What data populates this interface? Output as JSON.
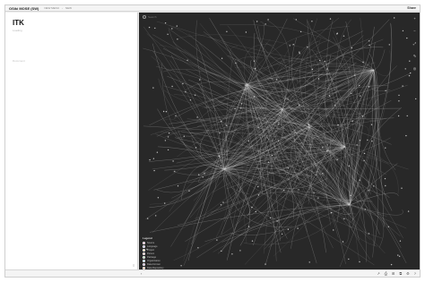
{
  "app": {
    "title": "OSiki MOSE (SW)",
    "breadcrumbs": [
      "NEW MENU",
      "NEW"
    ],
    "top_action": "Share"
  },
  "left_pane": {
    "title": "ITK",
    "subtitle": "Loading",
    "doc_hint": "Document",
    "corner_icon": "≡"
  },
  "graph": {
    "search_placeholder": "Search",
    "tools": [
      "+",
      "−",
      "⤢",
      "✎",
      "◎"
    ],
    "edge_color": "#d7d7d7",
    "background": "#282828"
  },
  "legend": {
    "title": "Legend",
    "items": [
      {
        "label": "Source",
        "color": "#c84b8c"
      },
      {
        "label": "Language",
        "color": "#6a5acd"
      },
      {
        "label": "Project",
        "color": "#d4a13a"
      },
      {
        "label": "Person",
        "color": "#e06666"
      },
      {
        "label": "Package",
        "color": "#4caf50"
      },
      {
        "label": "Organization",
        "color": "#3fa7c9"
      },
      {
        "label": "Data Format",
        "color": "#9b59b6"
      },
      {
        "label": "Data Repository",
        "color": "#e67e22"
      }
    ]
  },
  "statusbar": {
    "left_icon": "‹",
    "icons": [
      "↗",
      "⎙",
      "⊞",
      "⧉",
      "⚙",
      "?"
    ]
  }
}
